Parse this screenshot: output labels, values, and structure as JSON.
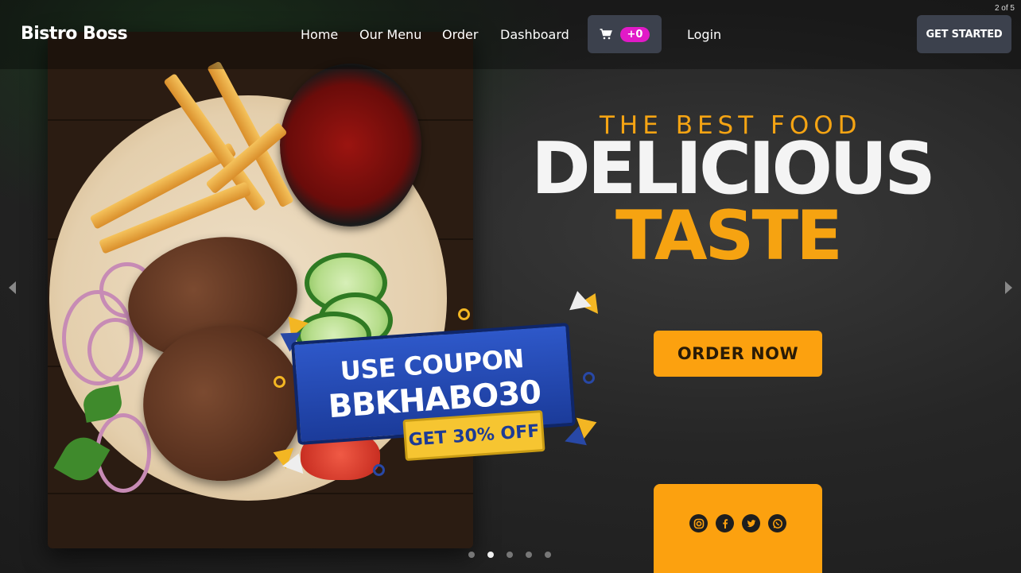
{
  "navbar": {
    "brand": "Bistro Boss",
    "links": [
      "Home",
      "Our Menu",
      "Order",
      "Dashboard"
    ],
    "cart_count": "+0",
    "login": "Login",
    "cta": "GET STARTED"
  },
  "carousel": {
    "counter": "2 of 5",
    "slide_count": 5,
    "active_index": 1
  },
  "hero": {
    "kicker": "THE BEST FOOD",
    "headline_line1": "DELICIOUS",
    "headline_line2": "TASTE",
    "order_button": "ORDER NOW",
    "coupon_line1": "USE COUPON",
    "coupon_line2": "BBKHABO30",
    "coupon_tag": "GET 30% OFF"
  },
  "social": [
    "instagram-icon",
    "facebook-icon",
    "twitter-icon",
    "whatsapp-icon"
  ],
  "colors": {
    "accent": "#fca10f",
    "badge": "#e11ac7",
    "nav_button": "#3c414d",
    "coupon_blue": "#1b3b9a"
  }
}
